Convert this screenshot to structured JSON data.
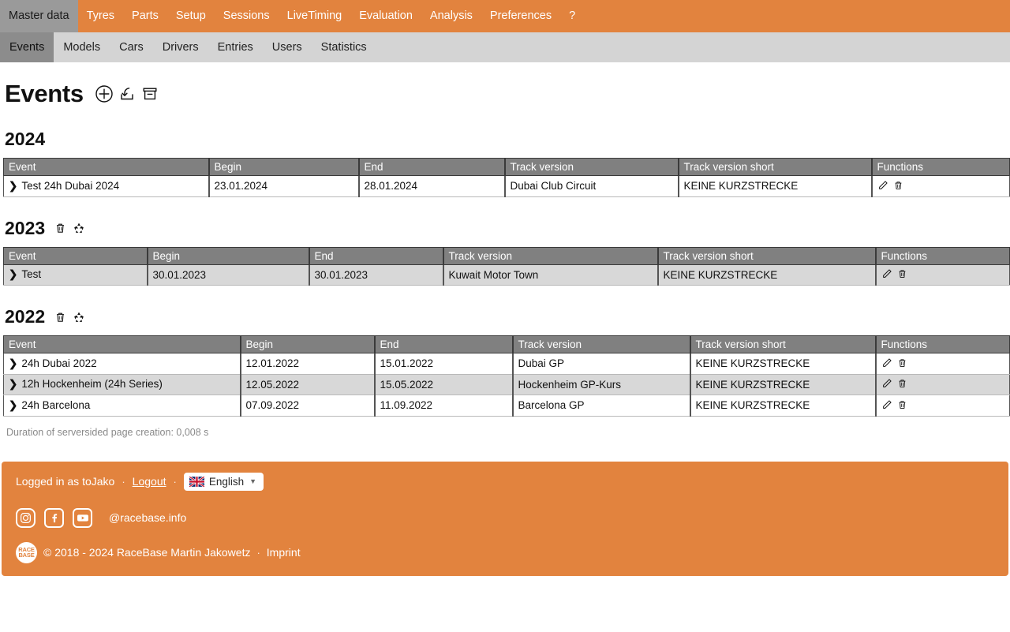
{
  "theme": {
    "accent": "#e2833e",
    "active_tab": "#9a9a9a",
    "subnav_bg": "#d4d4d4",
    "subnav_active": "#8c8c8c",
    "table_header": "#808080",
    "row_alt": "#d8d8d8"
  },
  "topnav": {
    "items": [
      {
        "label": "Master data",
        "active": true
      },
      {
        "label": "Tyres",
        "active": false
      },
      {
        "label": "Parts",
        "active": false
      },
      {
        "label": "Setup",
        "active": false
      },
      {
        "label": "Sessions",
        "active": false
      },
      {
        "label": "LiveTiming",
        "active": false
      },
      {
        "label": "Evaluation",
        "active": false
      },
      {
        "label": "Analysis",
        "active": false
      },
      {
        "label": "Preferences",
        "active": false
      },
      {
        "label": "?",
        "active": false
      }
    ]
  },
  "subnav": {
    "items": [
      {
        "label": "Events",
        "active": true
      },
      {
        "label": "Models",
        "active": false
      },
      {
        "label": "Cars",
        "active": false
      },
      {
        "label": "Drivers",
        "active": false
      },
      {
        "label": "Entries",
        "active": false
      },
      {
        "label": "Users",
        "active": false
      },
      {
        "label": "Statistics",
        "active": false
      }
    ]
  },
  "page": {
    "title": "Events",
    "title_icons": [
      "plus-circle-icon",
      "import-icon",
      "archive-icon"
    ]
  },
  "table_columns": [
    "Event",
    "Begin",
    "End",
    "Track version",
    "Track version short",
    "Functions"
  ],
  "sections": [
    {
      "year": "2024",
      "icons": [],
      "rows": [
        {
          "event": "Test 24h Dubai 2024",
          "begin": "23.01.2024",
          "end": "28.01.2024",
          "track_version": "Dubai Club Circuit",
          "track_version_short": "KEINE KURZSTRECKE"
        }
      ]
    },
    {
      "year": "2023",
      "icons": [
        "trash-icon",
        "recycle-icon"
      ],
      "rows": [
        {
          "event": "Test",
          "begin": "30.01.2023",
          "end": "30.01.2023",
          "track_version": "Kuwait Motor Town",
          "track_version_short": "KEINE KURZSTRECKE"
        }
      ]
    },
    {
      "year": "2022",
      "icons": [
        "trash-icon",
        "recycle-icon"
      ],
      "rows": [
        {
          "event": "24h Dubai 2022",
          "begin": "12.01.2022",
          "end": "15.01.2022",
          "track_version": "Dubai GP",
          "track_version_short": "KEINE KURZSTRECKE"
        },
        {
          "event": "12h Hockenheim (24h Series)",
          "begin": "12.05.2022",
          "end": "15.05.2022",
          "track_version": "Hockenheim GP-Kurs",
          "track_version_short": "KEINE KURZSTRECKE"
        },
        {
          "event": "24h Barcelona",
          "begin": "07.09.2022",
          "end": "11.09.2022",
          "track_version": "Barcelona GP",
          "track_version_short": "KEINE KURZSTRECKE"
        }
      ]
    }
  ],
  "duration_text": "Duration of serversided page creation: 0,008 s",
  "footer": {
    "logged_in_text": "Logged in as toJako",
    "separator": "·",
    "logout_label": "Logout",
    "language_label": "English",
    "handle": "@racebase.info",
    "logo_line1": "RACE",
    "logo_line2": "BASE",
    "copyright": "© 2018 - 2024 RaceBase Martin Jakowetz",
    "imprint_label": "Imprint"
  }
}
